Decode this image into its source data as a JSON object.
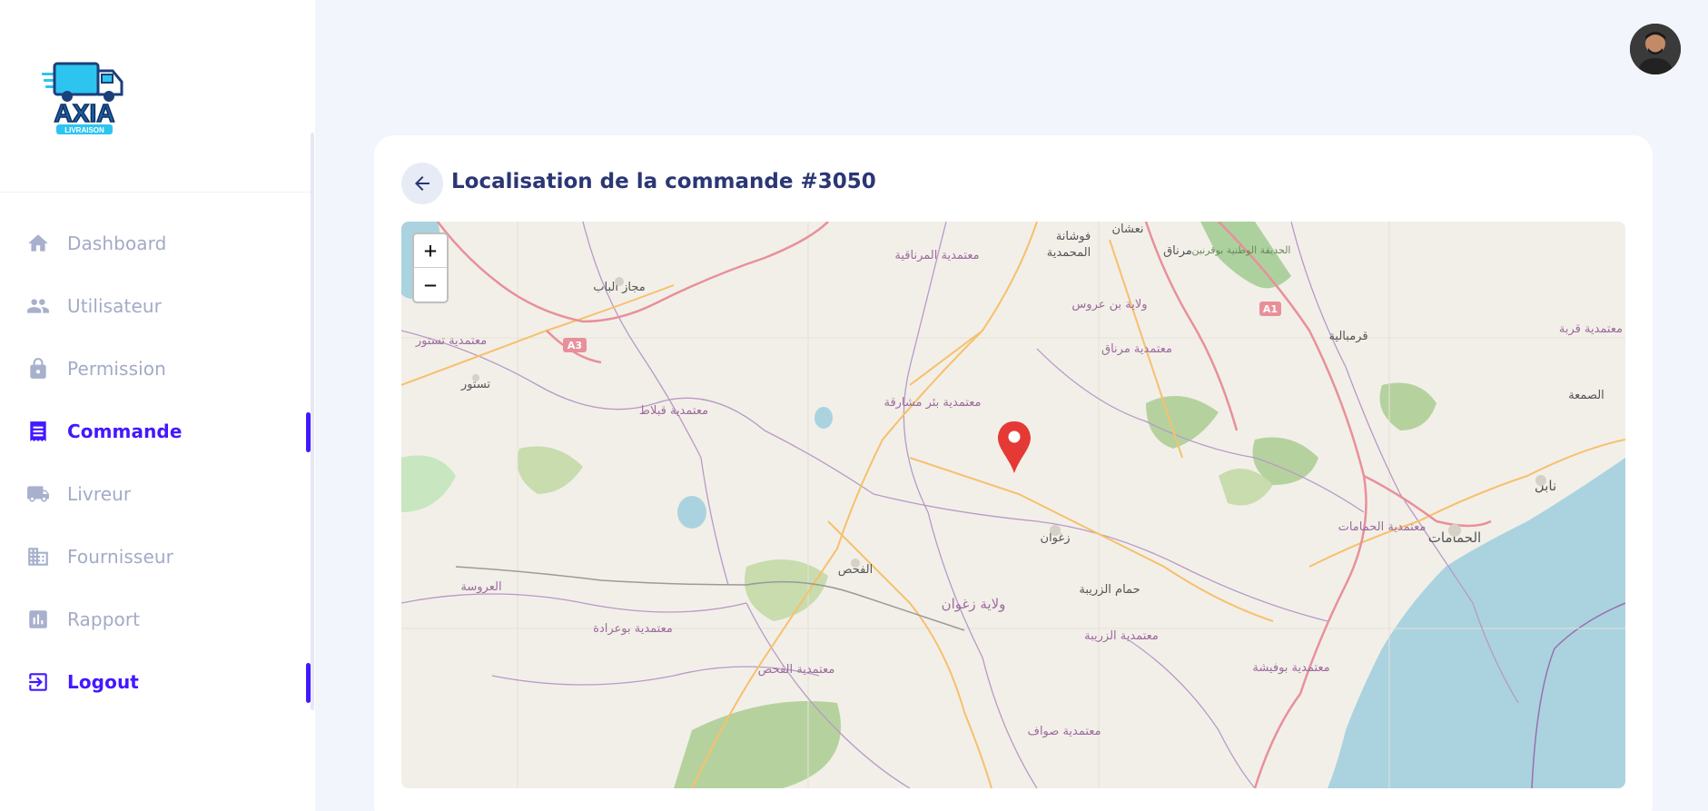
{
  "brand": {
    "logo_text": "AXIA",
    "logo_subtext": "LIVRAISON",
    "colors": {
      "primary": "#4318ff",
      "muted": "#a3aac6",
      "title": "#2b3674",
      "background": "#f3f5fc"
    }
  },
  "sidebar": {
    "items": [
      {
        "label": "Dashboard",
        "icon": "home-icon",
        "active": false
      },
      {
        "label": "Utilisateur",
        "icon": "users-icon",
        "active": false
      },
      {
        "label": "Permission",
        "icon": "lock-icon",
        "active": false
      },
      {
        "label": "Commande",
        "icon": "receipt-icon",
        "active": true
      },
      {
        "label": "Livreur",
        "icon": "truck-icon",
        "active": false
      },
      {
        "label": "Fournisseur",
        "icon": "building-icon",
        "active": false
      },
      {
        "label": "Rapport",
        "icon": "bar-chart-icon",
        "active": false
      },
      {
        "label": "Logout",
        "icon": "logout-icon",
        "active": true
      }
    ]
  },
  "header": {
    "avatar_icon": "user-avatar"
  },
  "page": {
    "title": "Localisation de la commande #3050",
    "back_icon": "arrow-left-icon"
  },
  "map": {
    "zoom_in": "+",
    "zoom_out": "−",
    "marker_icon": "map-pin-icon",
    "labels": [
      "معتمدية المرناقية",
      "فوشانة",
      "نعشان",
      "المحمدية",
      "مرناق",
      "الحديقة الوطنية بوقرنين",
      "A1",
      "مجاز الباب",
      "ولاية بن عروس",
      "A3",
      "معتمدية تستور",
      "معتمدية مرناق",
      "قرمبالية",
      "معتمدية قربة",
      "تستور",
      "معتمدية بئر مشارقة",
      "معتمدية قبلاط",
      "الصمعة",
      "نابل",
      "زغوان",
      "معتمدية الحمامات",
      "الحمامات",
      "الفحص",
      "العروسة",
      "حمام الزريبة",
      "ولاية زغوان",
      "معتمدية بوعرادة",
      "معتمدية الزريبة",
      "معتمدية الفحص",
      "معتمدية بوفيشة",
      "معتمدية صواف"
    ]
  }
}
